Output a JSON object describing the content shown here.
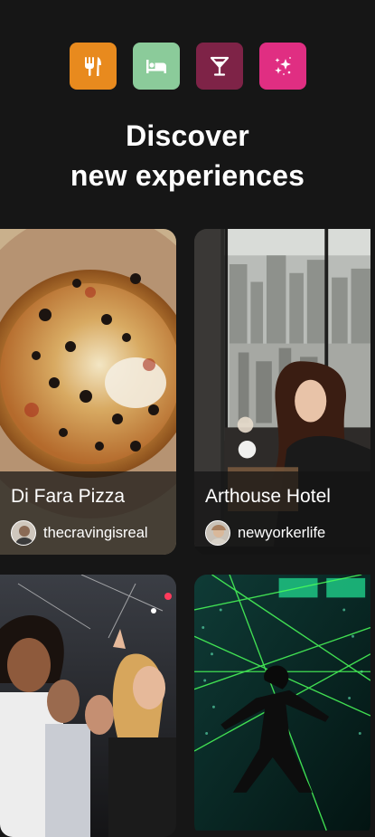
{
  "categories": [
    {
      "name": "restaurants",
      "icon": "fork-knife-icon",
      "color": "#E88A1E"
    },
    {
      "name": "hotels",
      "icon": "bed-icon",
      "color": "#8BCB9A"
    },
    {
      "name": "bars",
      "icon": "cocktail-icon",
      "color": "#7E2347"
    },
    {
      "name": "experiences",
      "icon": "sparkles-icon",
      "color": "#E02E82"
    }
  ],
  "headline": {
    "line1": "Discover",
    "line2": "new experiences"
  },
  "cards": [
    {
      "place": "Di Fara Pizza",
      "user": "thecravingisreal"
    },
    {
      "place": "Arthouse Hotel",
      "user": "newyorkerlife"
    },
    {
      "place": "",
      "user": ""
    },
    {
      "place": "",
      "user": ""
    }
  ]
}
